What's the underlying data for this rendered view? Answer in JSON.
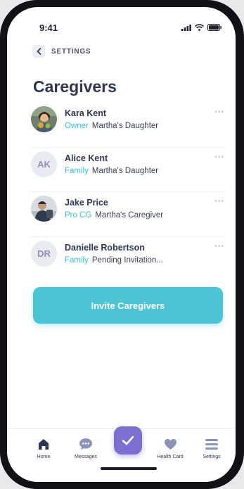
{
  "status": {
    "time": "9:41"
  },
  "header": {
    "back_label": "SETTINGS",
    "title": "Caregivers"
  },
  "caregivers": [
    {
      "name": "Kara Kent",
      "role": "Owner",
      "relation": "Martha's Daughter",
      "initials": ""
    },
    {
      "name": "Alice Kent",
      "role": "Family",
      "relation": "Martha's Daughter",
      "initials": "AK"
    },
    {
      "name": "Jake Price",
      "role": "Pro CG",
      "relation": "Martha's Caregiver",
      "initials": ""
    },
    {
      "name": "Danielle Robertson",
      "role": "Family",
      "relation": "Pending Invitation...",
      "initials": "DR"
    }
  ],
  "actions": {
    "invite_label": "Invite Caregivers"
  },
  "tabs": {
    "home": "Home",
    "messages": "Messages",
    "health_card": "Health Card",
    "settings": "Settings"
  },
  "colors": {
    "accent": "#4cc4d3",
    "role": "#3cc1d3",
    "primary": "#7b6fcf",
    "text": "#2f3652"
  }
}
